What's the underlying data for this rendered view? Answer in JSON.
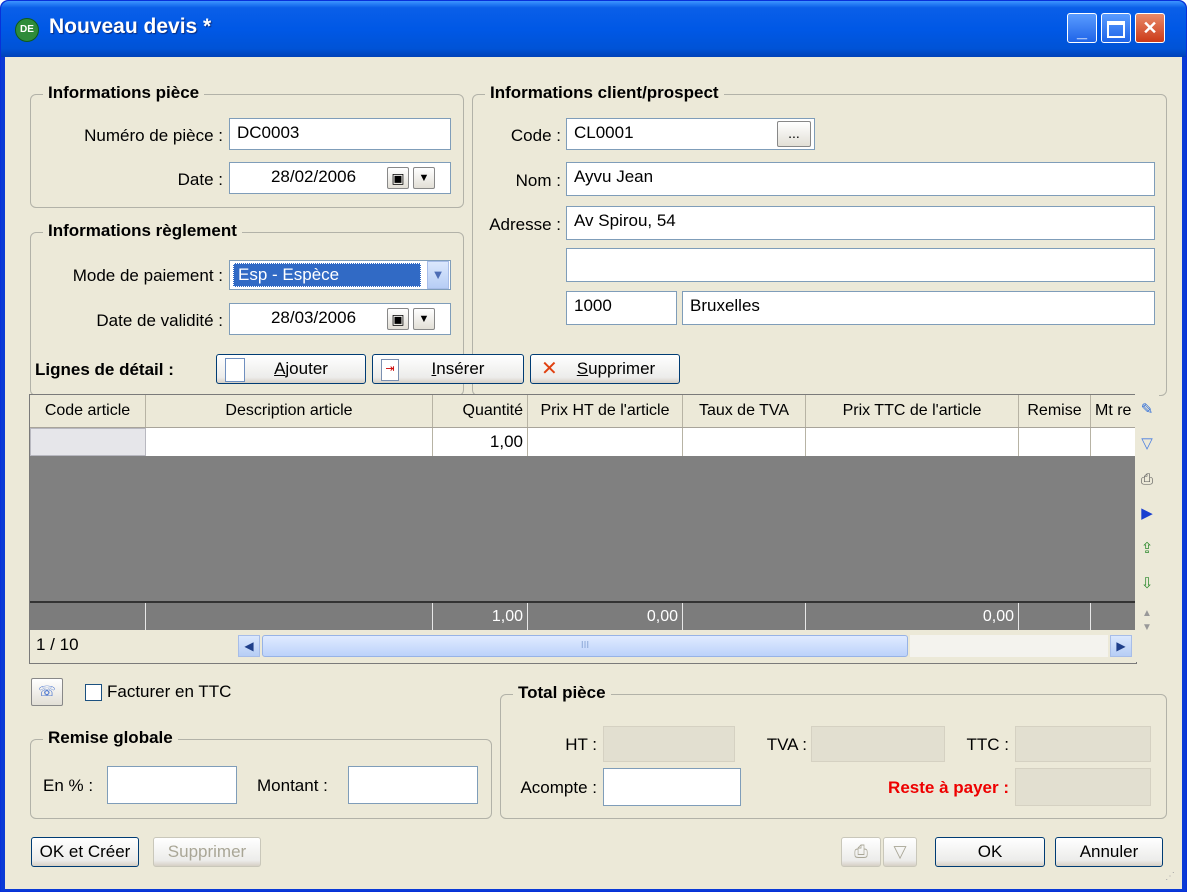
{
  "window": {
    "title": "Nouveau devis *",
    "app_badge": "DE"
  },
  "piece": {
    "title": "Informations pièce",
    "numero_label": "Numéro de pièce :",
    "numero_value": "DC0003",
    "date_label": "Date :",
    "date_value": "28/02/2006"
  },
  "reglement": {
    "title": "Informations règlement",
    "mode_label": "Mode de paiement :",
    "mode_value": "Esp - Espèce",
    "validite_label": "Date de validité :",
    "validite_value": "28/03/2006"
  },
  "client": {
    "title": "Informations client/prospect",
    "code_label": "Code :",
    "code_value": "CL0001",
    "browse_label": "...",
    "nom_label": "Nom :",
    "nom_value": "Ayvu Jean",
    "adresse_label": "Adresse :",
    "adresse_line1": "Av Spirou, 54",
    "adresse_line2": "",
    "cp": "1000",
    "ville": "Bruxelles"
  },
  "lines_toolbar": {
    "label": "Lignes de détail :",
    "ajouter_a": "A",
    "ajouter_b": "jouter",
    "inserer_a": "I",
    "inserer_b": "nsérer",
    "supprimer_a": "S",
    "supprimer_b": "upprimer"
  },
  "grid": {
    "columns": [
      "Code article",
      "Description article",
      "Quantité",
      "Prix HT de l'article",
      "Taux de TVA",
      "Prix TTC de l'article",
      "Remise",
      "Mt re"
    ],
    "row": {
      "quantite": "1,00"
    },
    "totals": {
      "quantite": "1,00",
      "prix_ht": "0,00",
      "prix_ttc": "0,00"
    },
    "page_info": "1 / 10",
    "scroll_grip": "III"
  },
  "facturer_ttc_label": "Facturer en TTC",
  "remise": {
    "title": "Remise globale",
    "pct_label": "En % :",
    "pct_value": "",
    "montant_label": "Montant :",
    "montant_value": ""
  },
  "total": {
    "title": "Total pièce",
    "ht_label": "HT :",
    "tva_label": "TVA :",
    "ttc_label": "TTC :",
    "acompte_label": "Acompte :",
    "reste_label": "Reste à payer :"
  },
  "footer": {
    "ok_creer": "OK et Créer",
    "supprimer": "Supprimer",
    "ok": "OK",
    "annuler": "Annuler"
  },
  "colors": {
    "title_bar": "#0058e6",
    "client_bg": "#ece9d8",
    "reste_label": "#e00000",
    "grid_bg": "#808080"
  }
}
